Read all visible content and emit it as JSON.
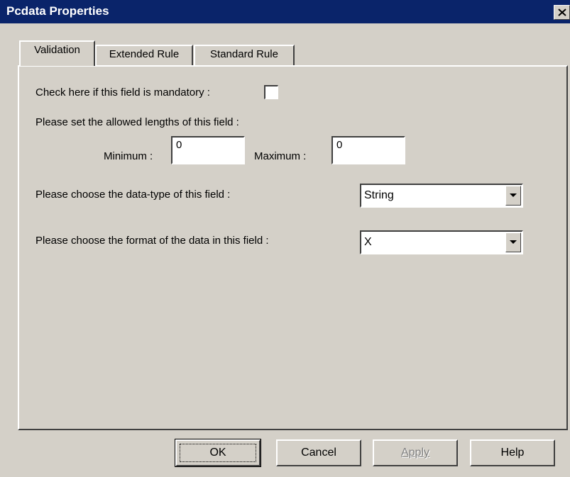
{
  "window": {
    "title": "Pcdata Properties"
  },
  "tabs": [
    {
      "label": "Validation",
      "active": true
    },
    {
      "label": "Extended Rule",
      "active": false
    },
    {
      "label": "Standard Rule",
      "active": false
    }
  ],
  "validation": {
    "mandatory_label": "Check here if this field is mandatory :",
    "mandatory_checked": false,
    "lengths_label": "Please set the allowed lengths of this field :",
    "minimum_label": "Minimum :",
    "minimum_value": "0",
    "maximum_label": "Maximum :",
    "maximum_value": "0",
    "datatype_label": "Please choose the data-type of this field :",
    "datatype_value": "String",
    "format_label": "Please choose the format of the data in this field :",
    "format_value": "X"
  },
  "buttons": {
    "ok": "OK",
    "cancel": "Cancel",
    "apply": "Apply",
    "apply_enabled": false,
    "help": "Help"
  },
  "icons": {
    "close": "close-icon",
    "dropdown": "chevron-down-icon"
  }
}
